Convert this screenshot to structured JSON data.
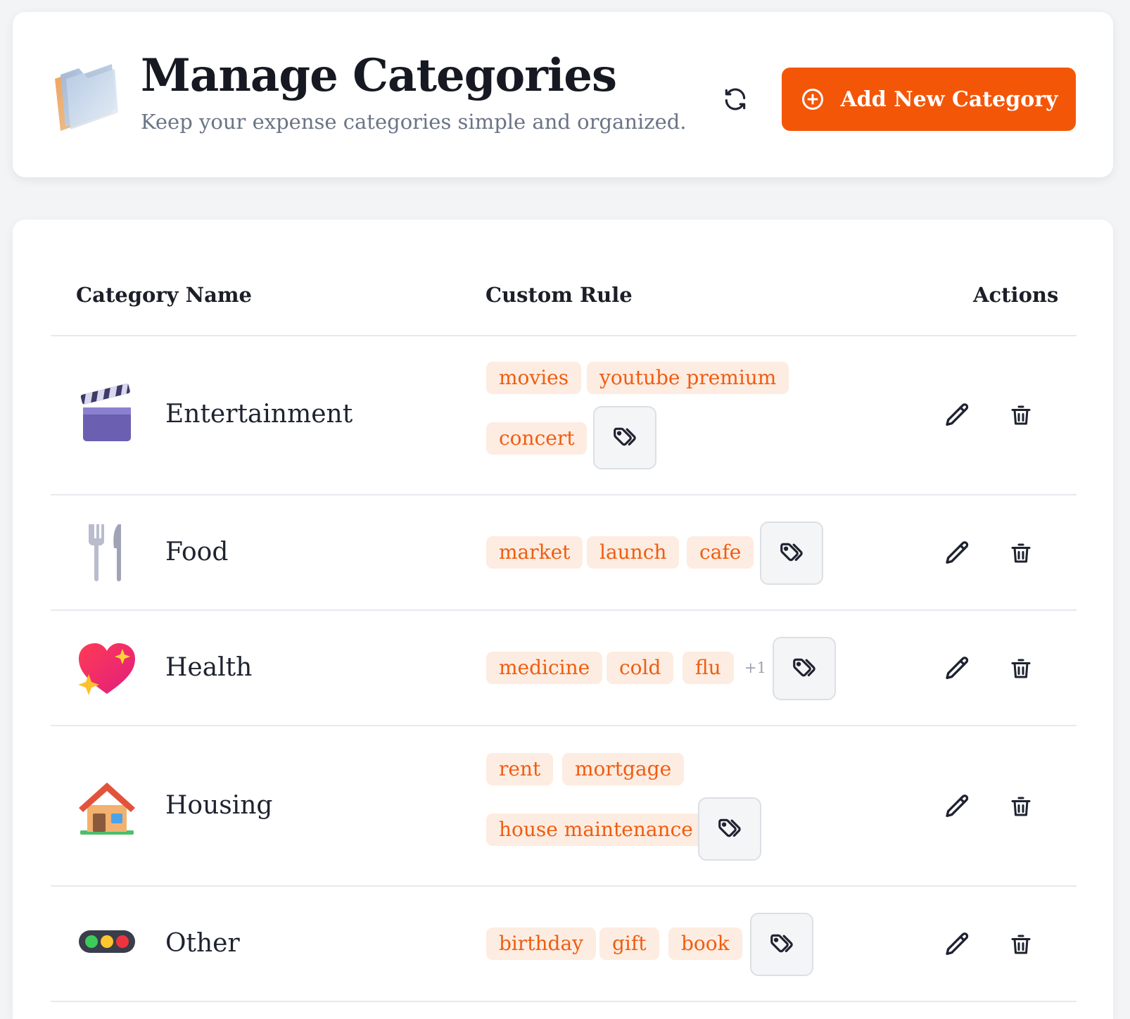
{
  "header": {
    "title": "Manage Categories",
    "subtitle": "Keep your expense categories simple and organized.",
    "add_button_label": "Add New Category"
  },
  "table": {
    "columns": [
      "Category Name",
      "Custom Rule",
      "Actions"
    ],
    "rows": [
      {
        "name": "Entertainment",
        "icon": "clapper-board-icon",
        "tags": [
          "movies",
          "youtube premium",
          "concert"
        ],
        "more": ""
      },
      {
        "name": "Food",
        "icon": "fork-and-knife-icon",
        "tags": [
          "market",
          "launch",
          "cafe"
        ],
        "more": ""
      },
      {
        "name": "Health",
        "icon": "sparkling-heart-icon",
        "tags": [
          "medicine",
          "cold",
          "flu"
        ],
        "more": "+1"
      },
      {
        "name": "Housing",
        "icon": "house-icon",
        "tags": [
          "rent",
          "mortgage",
          "house maintenance"
        ],
        "more": ""
      },
      {
        "name": "Other",
        "icon": "traffic-light-icon",
        "tags": [
          "birthday",
          "gift",
          "book"
        ],
        "more": ""
      }
    ]
  },
  "colors": {
    "accent": "#f45608",
    "tag_bg": "#fdece1",
    "tag_text": "#ef5d10"
  }
}
